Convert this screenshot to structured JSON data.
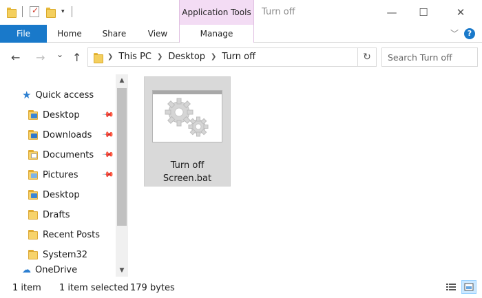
{
  "title_bar": {
    "context_tab": "Application Tools",
    "window_title": "Turn off",
    "minimize": "—",
    "maximize": "☐",
    "close": "✕"
  },
  "ribbon": {
    "tabs": [
      "File",
      "Home",
      "Share",
      "View",
      "Manage"
    ]
  },
  "nav": {
    "back": "←",
    "forward": "→",
    "recent": "⌄",
    "up": "↑"
  },
  "address": {
    "crumbs": [
      "This PC",
      "Desktop",
      "Turn off"
    ]
  },
  "search": {
    "placeholder": "Search Turn off"
  },
  "navpane": {
    "quick_access": "Quick access",
    "items": [
      {
        "label": "Desktop",
        "pinned": true
      },
      {
        "label": "Downloads",
        "pinned": true
      },
      {
        "label": "Documents",
        "pinned": true
      },
      {
        "label": "Pictures",
        "pinned": true
      },
      {
        "label": "Desktop",
        "pinned": false
      },
      {
        "label": "Drafts",
        "pinned": false
      },
      {
        "label": "Recent Posts",
        "pinned": false
      },
      {
        "label": "System32",
        "pinned": false
      }
    ],
    "next_partial": "OneDrive"
  },
  "files": [
    {
      "name_line1": "Turn off",
      "name_line2": "Screen.bat",
      "selected": true
    }
  ],
  "status": {
    "count": "1 item",
    "selected": "1 item selected",
    "size": "179 bytes"
  },
  "colors": {
    "file_tab": "#1979ca",
    "context_tab": "#f3dcf4",
    "selection": "#d9d9d9"
  }
}
